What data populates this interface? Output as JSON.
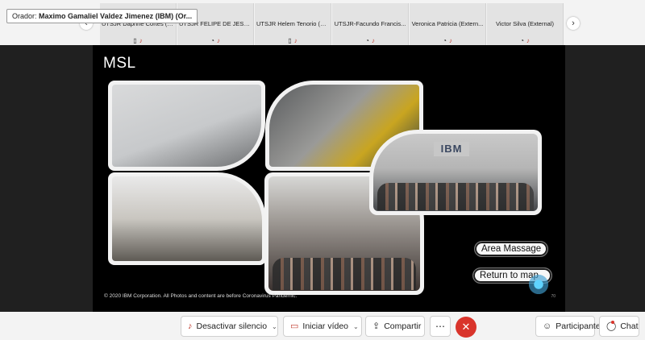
{
  "speaker": {
    "prefix": "Orador:",
    "name": "Maximo Gamaliel Valdez Jimenez (IBM) (Or..."
  },
  "participants": [
    {
      "name": "UTSJR Dapnne Cortes (E...",
      "video_icon": "▯",
      "mic_icon": "♪"
    },
    {
      "name": "UTSJR FELIPE DE JESUS ...",
      "video_icon": "◔",
      "mic_icon": "♪"
    },
    {
      "name": "UTSJR Helem Tenorio (E...",
      "video_icon": "▯",
      "mic_icon": "♪"
    },
    {
      "name": "UTSJR-Facundo Francis...",
      "video_icon": "◔",
      "mic_icon": "♪"
    },
    {
      "name": "Veronica Patricia (Extern...",
      "video_icon": "◔",
      "mic_icon": "♪"
    },
    {
      "name": "Victor Silva (External)",
      "video_icon": "◔",
      "mic_icon": "♪"
    }
  ],
  "strip_nav": {
    "prev": "‹",
    "next": "›"
  },
  "slide": {
    "title": "MSL",
    "ibm_logo": "IBM",
    "button_area": "Area Massage",
    "button_return": "Return to map",
    "copyright": "© 2020 IBM Corporation. All Photos and content are before Coronavirus Pandemic.",
    "page_number": "70"
  },
  "controls": {
    "mute": "Desactivar silencio",
    "video": "Iniciar vídeo",
    "share": "Compartir",
    "more": "⋯",
    "end": "✕",
    "participants": "Participantes",
    "chat": "Chat"
  },
  "colors": {
    "end_button": "#d9342b",
    "mic_muted": "#c0392b",
    "stage_bg": "#202020"
  }
}
